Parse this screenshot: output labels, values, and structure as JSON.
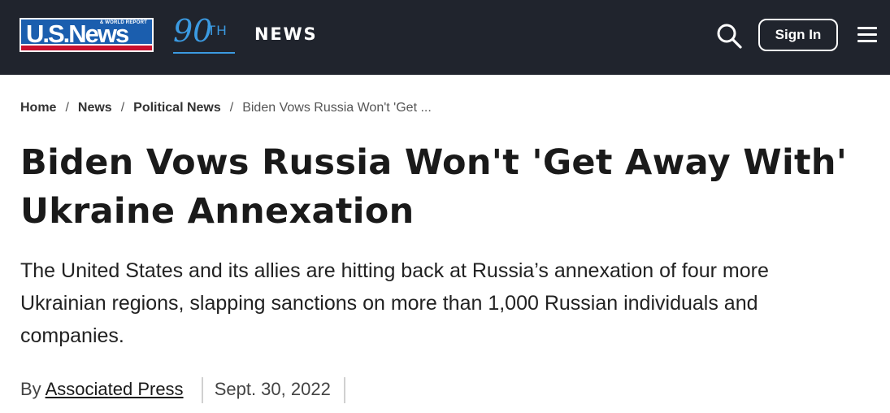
{
  "header": {
    "logo_text": "U.S.News",
    "logo_subtext": "& WORLD REPORT",
    "anniversary_number": "90",
    "anniversary_suffix": "TH",
    "section_label": "NEWS",
    "search_icon": "search-icon",
    "signin_label": "Sign In",
    "menu_icon": "hamburger-menu-icon",
    "colors": {
      "background": "#20242d",
      "logo_blue": "#1b5eae",
      "logo_red": "#c8102e",
      "anniversary_blue": "#3b9ae1"
    }
  },
  "breadcrumb": {
    "items": [
      "Home",
      "News",
      "Political News"
    ],
    "separator": "/",
    "current": "Biden Vows Russia Won't 'Get ..."
  },
  "article": {
    "headline": "Biden Vows Russia Won't 'Get Away With' Ukraine Annexation",
    "deck": "The United States and its allies are hitting back at Russia’s annexation of four more Ukrainian regions, slapping sanctions on more than 1,000 Russian individuals and companies.",
    "byline_prefix": "By",
    "author": "Associated Press",
    "date": "Sept. 30, 2022"
  }
}
